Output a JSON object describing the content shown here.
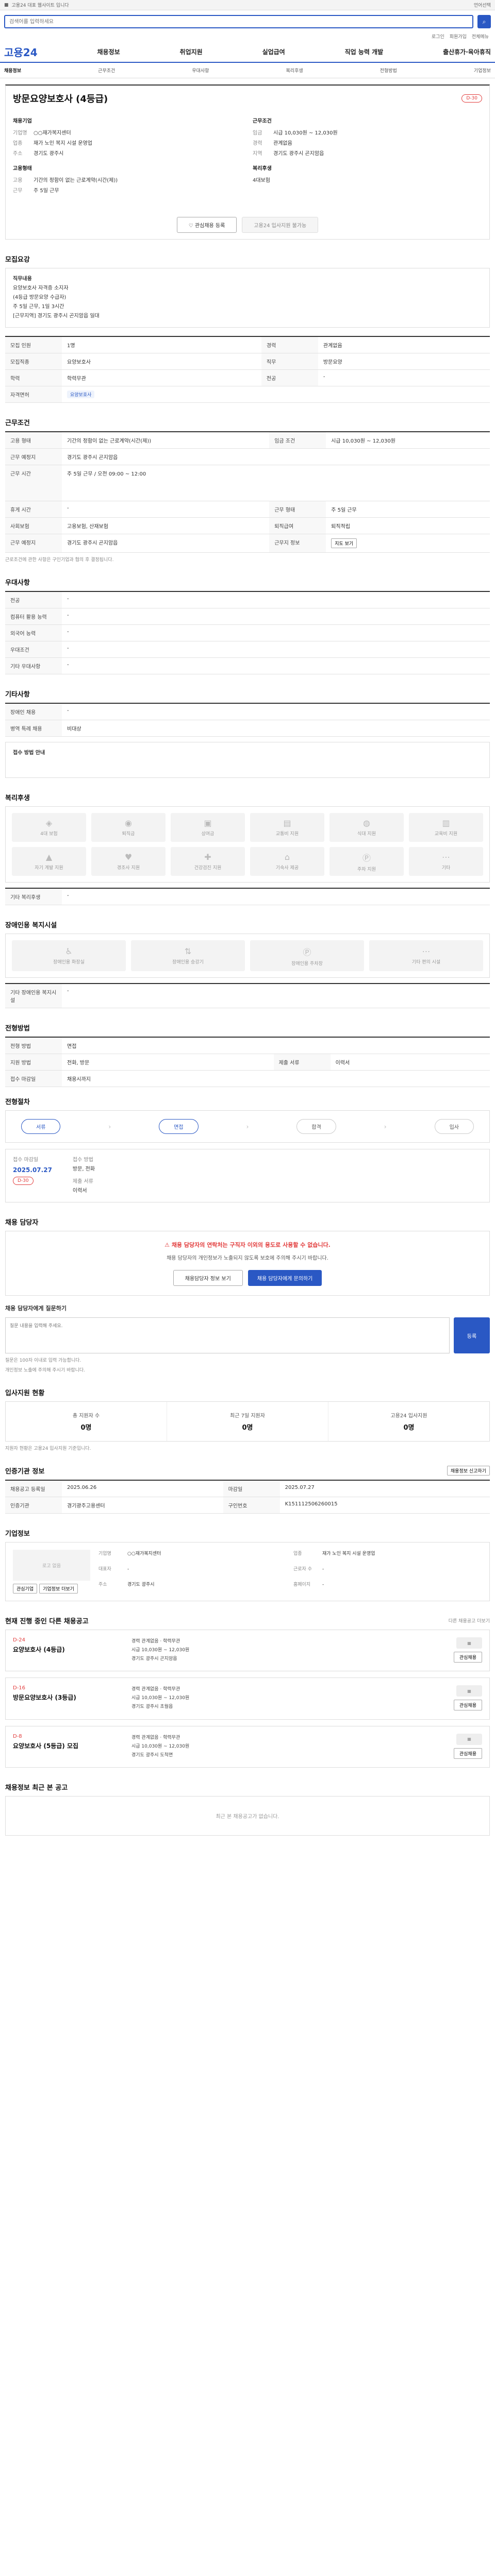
{
  "topbar": {
    "notice": "고용24 대표 웹사이트 입니다",
    "lang": "언어선택"
  },
  "search": {
    "placeholder": "검색어를 입력하세요",
    "btn": "⌕"
  },
  "util": {
    "login": "로그인",
    "join": "회원가입",
    "sitemap": "전체메뉴"
  },
  "gnb": {
    "logo": "고용24",
    "items": [
      "채용정보",
      "취업지원",
      "실업급여",
      "직업 능력 개발",
      "출산휴가·육아휴직"
    ]
  },
  "subnav": {
    "items": [
      "채용정보",
      "근무조건",
      "우대사항",
      "복리후생",
      "전형방법",
      "기업정보"
    ]
  },
  "header": {
    "title": "방문요양보호사 (4등급)",
    "dday": "D-30",
    "company_title": "채용기업",
    "company": [
      {
        "k": "기업명",
        "v": "○○재가복지센터"
      },
      {
        "k": "업종",
        "v": "재가 노인 복지 시설 운영업"
      },
      {
        "k": "주소",
        "v": "경기도 광주시"
      }
    ],
    "cond_title": "근무조건",
    "cond": [
      {
        "k": "임금",
        "v": "시급 10,030원 ~ 12,030원"
      },
      {
        "k": "경력",
        "v": "관계없음"
      },
      {
        "k": "지역",
        "v": "경기도 광주시 곤지암읍"
      }
    ],
    "req_title": "지원자격",
    "req": [
      {
        "k": "학력",
        "v": "학력무관"
      },
      {
        "k": "자격",
        "v": "요양보호사"
      }
    ],
    "form_title": "고용형태",
    "form": [
      {
        "k": "고용",
        "v": "기간의 정함이 없는 근로계약(시간(제))"
      },
      {
        "k": "근무",
        "v": "주 5일 근무"
      }
    ],
    "welfare_title": "복리후생",
    "welfare_val": "4대보험",
    "btn_scrap": "관심채용 등록",
    "btn_apply": "고용24 입사지원 불가능"
  },
  "job_content": {
    "title": "모집요강",
    "lines": [
      "직무내용",
      "요양보호사 자격증 소지자",
      "(4등급 방문요양 수급자)",
      "주 5일 근무, 1일 3시간",
      "[근무지역] 경기도 광주시 곤지암읍 일대"
    ]
  },
  "recruit": {
    "rows": [
      {
        "k": "모집 인원",
        "v": "1명",
        "k2": "경력",
        "v2": "관계없음"
      },
      {
        "k": "모집직종",
        "v": "요양보호사",
        "k2": "직무",
        "v2": "방문요양"
      },
      {
        "k": "학력",
        "v": "학력무관",
        "k2": "전공",
        "v2": "-"
      },
      {
        "k": "자격면허",
        "v": "요양보호사",
        "k2": "",
        "v2": ""
      }
    ]
  },
  "work": {
    "title": "근무조건",
    "rows": [
      {
        "k": "고용 형태",
        "v": "기간의 정함이 없는 근로계약(시간(제))",
        "k2": "임금 조건",
        "v2": "시급 10,030원 ~ 12,030원"
      },
      {
        "k": "근무 예정지",
        "v": "경기도 광주시 곤지암읍",
        "k2": "",
        "v2": ""
      },
      {
        "k": "근무 시간",
        "v": "주 5일 근무 / 오전 09:00 ~ 12:00",
        "k2": "",
        "v2": ""
      },
      {
        "k": "휴게 시간",
        "v": "-",
        "k2": "근무 형태",
        "v2": "주 5일 근무"
      },
      {
        "k": "사회보험",
        "v": "고용보험, 산재보험",
        "k2": "퇴직급여",
        "v2": "퇴직적립"
      },
      {
        "k": "근무 예정지",
        "v": "경기도 광주시 곤지암읍",
        "k2": "근무지 정보",
        "v2": "지도 보기"
      }
    ],
    "note": "근로조건에 관한 사항은 구인기업과 협의 후 결정됩니다.",
    "map_btn": "지도 보기"
  },
  "prefer": {
    "title": "우대사항",
    "rows": [
      {
        "k": "전공",
        "v": "-"
      },
      {
        "k": "컴퓨터 활용 능력",
        "v": "-"
      },
      {
        "k": "외국어 능력",
        "v": "-"
      },
      {
        "k": "우대조건",
        "v": "-"
      },
      {
        "k": "기타 우대사항",
        "v": "-"
      }
    ]
  },
  "etc": {
    "title": "기타사항",
    "rows": [
      {
        "k": "장애인 채용",
        "v": "-"
      },
      {
        "k": "병역 특례 채용",
        "v": "비대상"
      }
    ],
    "apply_title": "접수 방법 안내"
  },
  "welfare": {
    "title": "복리후생",
    "items": [
      "4대 보험",
      "퇴직금",
      "상여금",
      "교통비 지원",
      "식대 지원",
      "교육비 지원",
      "자기 계발 지원",
      "경조사 지원",
      "건강검진 지원",
      "기숙사 제공",
      "주차 지원",
      "기타"
    ],
    "etc_title": "기타 복리후생",
    "etc_val": "-"
  },
  "disability": {
    "title": "장애인용 복지시설",
    "items": [
      "장애인용 화장실",
      "장애인용 승강기",
      "장애인용 주차장",
      "기타 편의 시설"
    ],
    "etc_title": "기타 장애인용 복지시설",
    "etc_val": "-"
  },
  "process": {
    "title": "전형방법",
    "rows": [
      {
        "k": "전형 방법",
        "v": "면접",
        "k2": "",
        "v2": ""
      },
      {
        "k": "지원 방법",
        "v": "전화, 방문",
        "k2": "제출 서류",
        "v2": "이력서"
      },
      {
        "k": "접수 마감일",
        "v": "채용시까지",
        "k2": "",
        "v2": ""
      }
    ],
    "steps_title": "전형절차",
    "steps": [
      "서류",
      "면접",
      "합격",
      "입사"
    ]
  },
  "apply": {
    "date_label": "접수 마감일",
    "date_val": "2025.07.27",
    "dday": "D-30",
    "method_label": "접수 방법",
    "method_val": "방문, 전화",
    "doc_label": "제출 서류",
    "doc_val": "이력서"
  },
  "manager": {
    "title": "채용 담당자",
    "warn": "채용 담당자의 연락처는 구직자 이외의 용도로 사용할 수 없습니다.",
    "text": "채용 담당자의 개인정보가 노출되지 않도록 보호에 주의해 주시기 바랍니다.",
    "btn1": "채용담당자 정보 보기",
    "btn2": "채용 담당자에게 문의하기"
  },
  "qa": {
    "title": "채용 담당자에게 질문하기",
    "placeholder": "질문 내용을 입력해 주세요.",
    "submit": "등록",
    "notes": [
      "질문은 100자 이내로 입력 가능합니다.",
      "개인정보 노출에 주의해 주시기 바랍니다."
    ]
  },
  "status": {
    "title": "입사지원 현황",
    "items": [
      {
        "lbl": "총 지원자 수",
        "num": "0명"
      },
      {
        "lbl": "최근 7일 지원자",
        "num": "0명"
      },
      {
        "lbl": "고용24 입사지원",
        "num": "0명"
      }
    ],
    "note": "지원자 현황은 고용24 입사지원 기준입니다."
  },
  "info": {
    "title": "인증기관 정보",
    "btn": "채용정보 신고하기",
    "rows": [
      {
        "k": "채용공고 등록일",
        "v": "2025.06.26",
        "k2": "마감일",
        "v2": "2025.07.27"
      },
      {
        "k": "인증기관",
        "v": "경기광주고용센터",
        "k2": "구인번호",
        "v2": "K151112506260015"
      }
    ]
  },
  "company": {
    "title": "기업정보",
    "logo": "로고 없음",
    "btn1": "관심기업",
    "btn2": "기업정보 더보기",
    "rows": [
      {
        "k": "기업명",
        "v": "○○재가복지센터"
      },
      {
        "k": "업종",
        "v": "재가 노인 복지 시설 운영업"
      },
      {
        "k": "대표자",
        "v": "-"
      },
      {
        "k": "근로자 수",
        "v": "-"
      },
      {
        "k": "주소",
        "v": "경기도 광주시"
      },
      {
        "k": "홈페이지",
        "v": "-"
      }
    ]
  },
  "others": {
    "title": "현재 진행 중인 다른 채용공고",
    "more": "다른 채용공고 더보기",
    "cards": [
      {
        "dday": "D-24",
        "title": "요양보호사 (4등급)",
        "l1": "경력 관계없음 · 학력무관",
        "l2": "시급 10,030원 ~ 12,030원",
        "l3": "경기도 광주시 곤지암읍",
        "btn": "관심채용"
      },
      {
        "dday": "D-16",
        "title": "방문요양보호사 (3등급)",
        "l1": "경력 관계없음 · 학력무관",
        "l2": "시급 10,030원 ~ 12,030원",
        "l3": "경기도 광주시 초월읍",
        "btn": "관심채용"
      },
      {
        "dday": "D-8",
        "title": "요양보호사 (5등급) 모집",
        "l1": "경력 관계없음 · 학력무관",
        "l2": "시급 10,030원 ~ 12,030원",
        "l3": "경기도 광주시 도척면",
        "btn": "관심채용"
      }
    ]
  },
  "recent": {
    "title": "채용정보 최근 본 공고",
    "empty": "최근 본 채용공고가 없습니다."
  }
}
